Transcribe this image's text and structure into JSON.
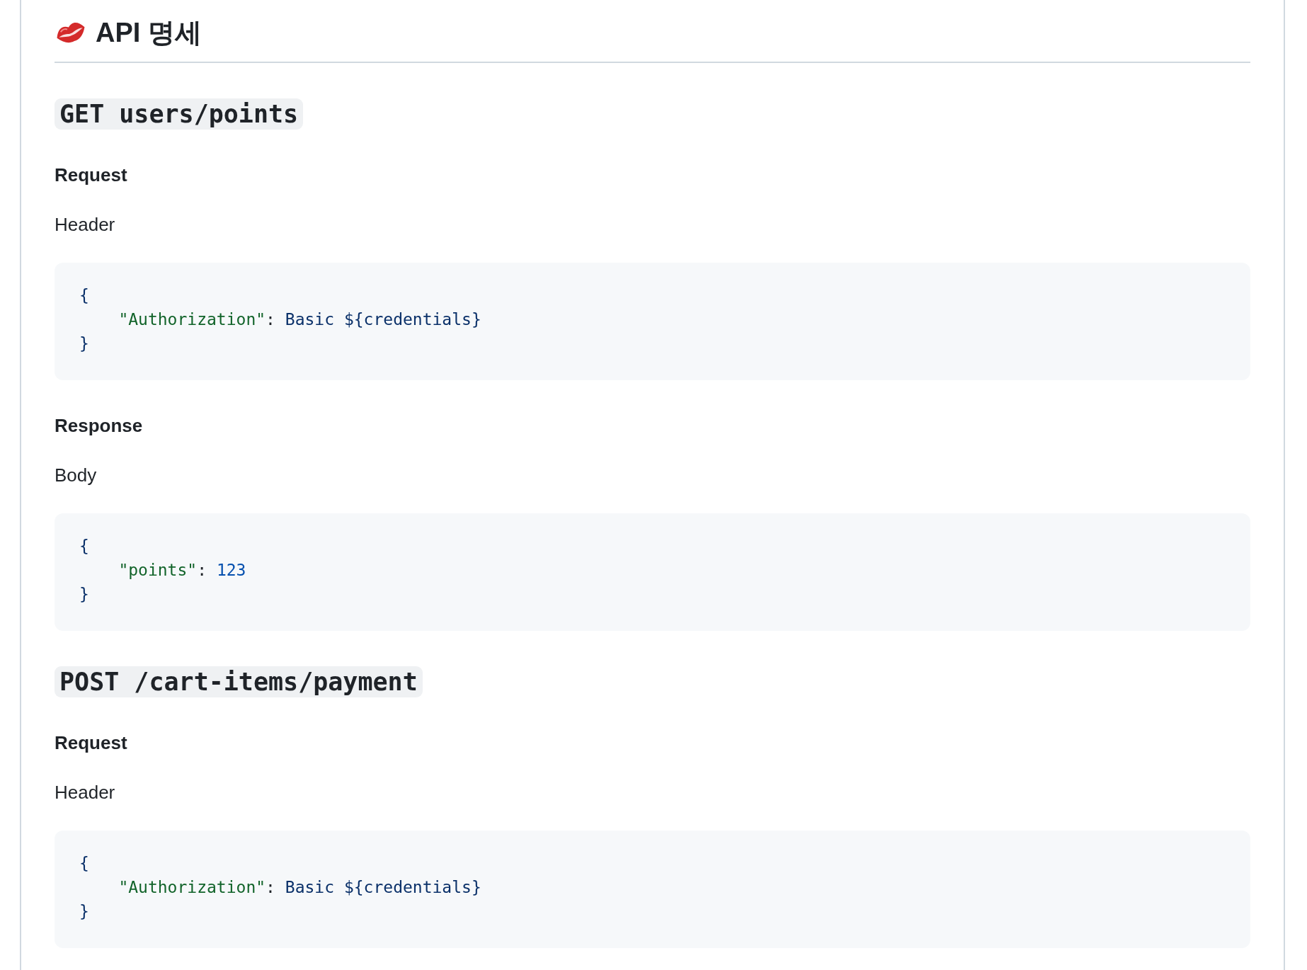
{
  "title": "API 명세",
  "blocks": [
    {
      "kind": "endpoint",
      "text": "GET users/points"
    },
    {
      "kind": "subheading",
      "text": "Request"
    },
    {
      "kind": "paragraph",
      "text": "Header"
    },
    {
      "kind": "code",
      "lines": [
        {
          "tokens": [
            {
              "kind": "brace",
              "text": "{"
            }
          ]
        },
        {
          "tokens": [
            {
              "kind": "key",
              "text": "    \"Authorization\""
            },
            {
              "kind": "colon",
              "text": ": "
            },
            {
              "kind": "value",
              "text": "Basic ${credentials}"
            }
          ]
        },
        {
          "tokens": [
            {
              "kind": "brace",
              "text": "}"
            }
          ]
        }
      ]
    },
    {
      "kind": "subheading",
      "text": "Response"
    },
    {
      "kind": "paragraph",
      "text": "Body"
    },
    {
      "kind": "code",
      "lines": [
        {
          "tokens": [
            {
              "kind": "brace",
              "text": "{"
            }
          ]
        },
        {
          "tokens": [
            {
              "kind": "key",
              "text": "    \"points\""
            },
            {
              "kind": "colon",
              "text": ": "
            },
            {
              "kind": "number",
              "text": "123"
            }
          ]
        },
        {
          "tokens": [
            {
              "kind": "brace",
              "text": "}"
            }
          ]
        }
      ]
    },
    {
      "kind": "endpoint",
      "text": "POST /cart-items/payment"
    },
    {
      "kind": "subheading",
      "text": "Request"
    },
    {
      "kind": "paragraph",
      "text": "Header"
    },
    {
      "kind": "code",
      "lines": [
        {
          "tokens": [
            {
              "kind": "brace",
              "text": "{"
            }
          ]
        },
        {
          "tokens": [
            {
              "kind": "key",
              "text": "    \"Authorization\""
            },
            {
              "kind": "colon",
              "text": ": "
            },
            {
              "kind": "value",
              "text": "Basic ${credentials}"
            }
          ]
        },
        {
          "tokens": [
            {
              "kind": "brace",
              "text": "}"
            }
          ]
        }
      ]
    }
  ]
}
